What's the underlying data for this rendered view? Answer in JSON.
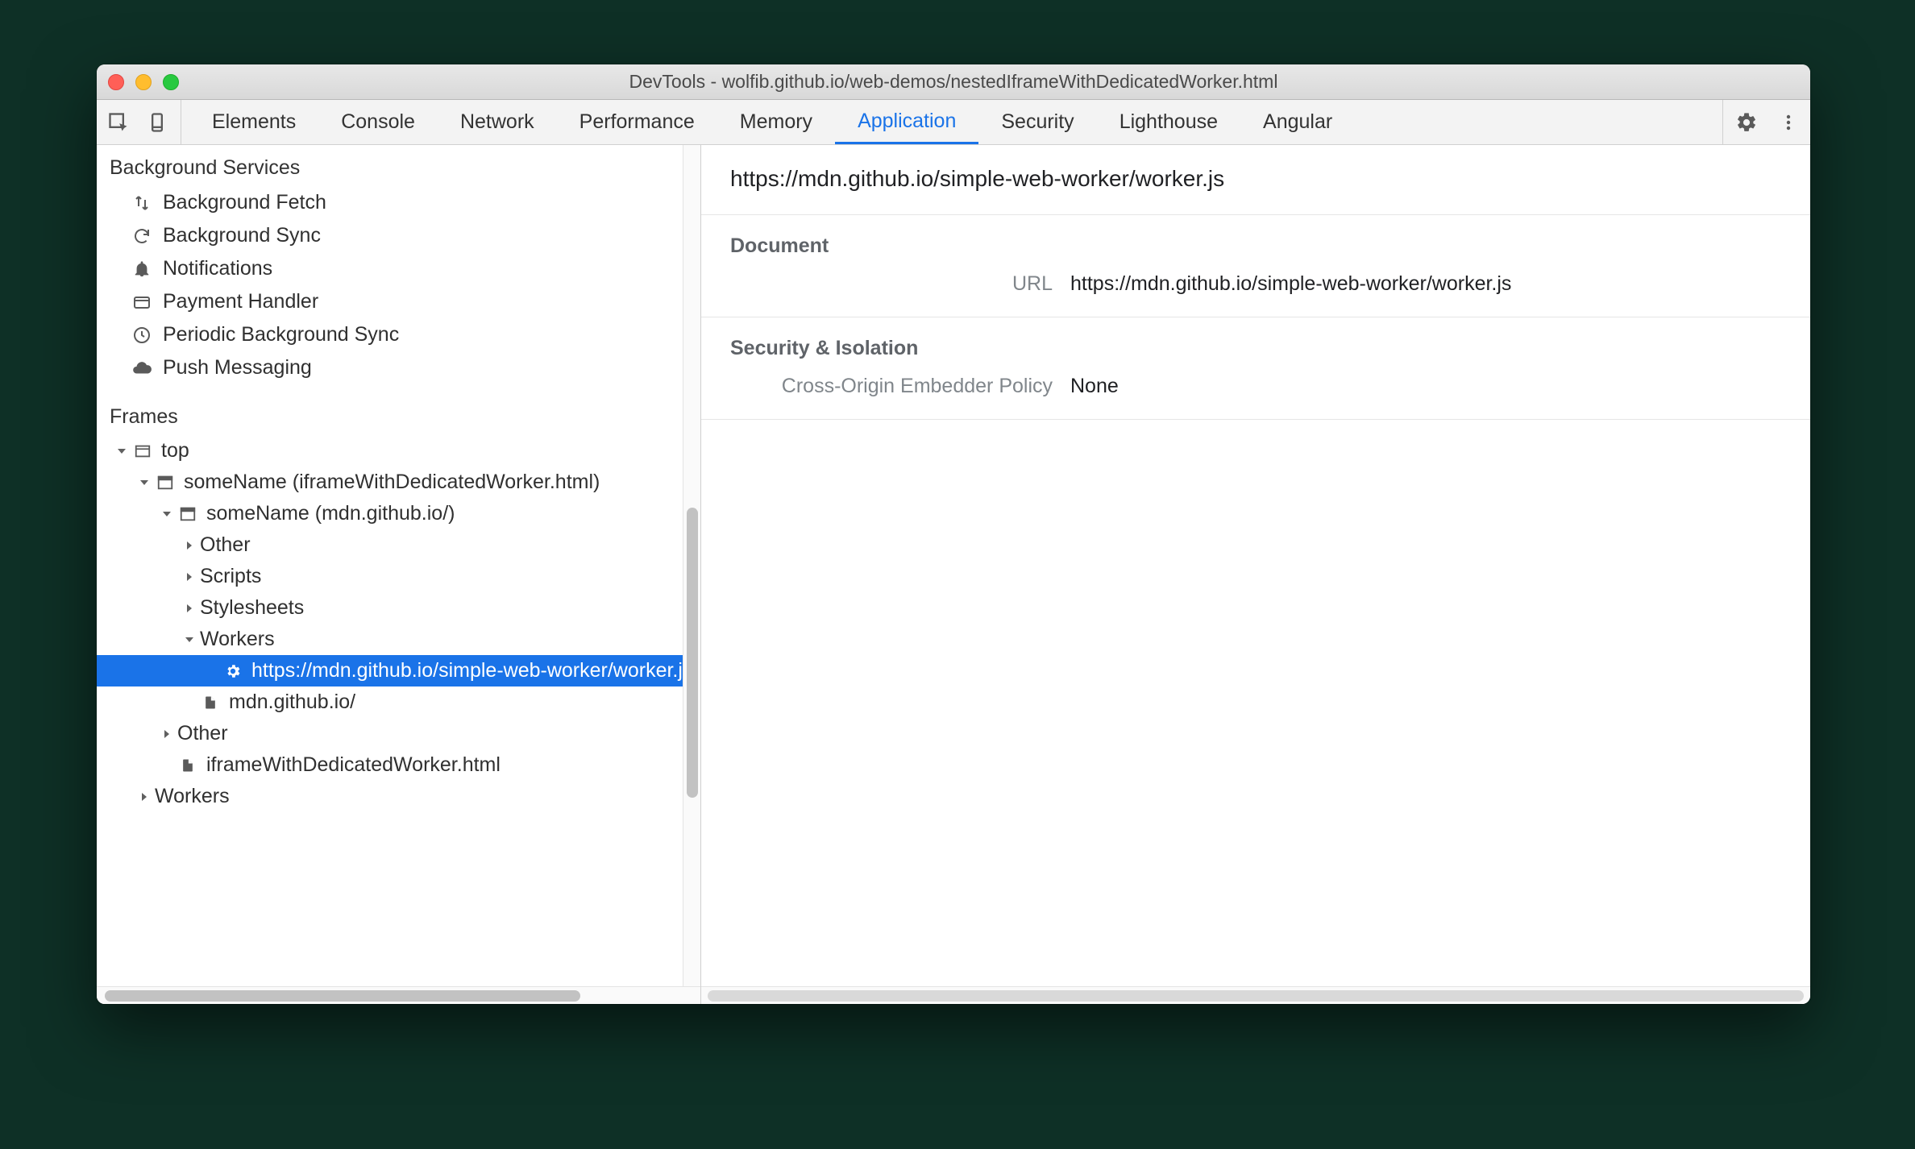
{
  "window": {
    "title": "DevTools - wolfib.github.io/web-demos/nestedIframeWithDedicatedWorker.html"
  },
  "tabs": [
    "Elements",
    "Console",
    "Network",
    "Performance",
    "Memory",
    "Application",
    "Security",
    "Lighthouse",
    "Angular"
  ],
  "activeTab": "Application",
  "sidebar": {
    "sections": {
      "bg": {
        "title": "Background Services",
        "items": [
          {
            "icon": "updown",
            "label": "Background Fetch"
          },
          {
            "icon": "sync",
            "label": "Background Sync"
          },
          {
            "icon": "bell",
            "label": "Notifications"
          },
          {
            "icon": "card",
            "label": "Payment Handler"
          },
          {
            "icon": "clock",
            "label": "Periodic Background Sync"
          },
          {
            "icon": "cloud",
            "label": "Push Messaging"
          }
        ]
      },
      "frames": {
        "title": "Frames",
        "tree": {
          "label": "top",
          "icon": "window",
          "expanded": true,
          "indent": 0,
          "children": [
            {
              "label": "someName (iframeWithDedicatedWorker.html)",
              "icon": "frame",
              "expanded": true,
              "indent": 1,
              "children": [
                {
                  "label": "someName (mdn.github.io/)",
                  "icon": "frame",
                  "expanded": true,
                  "indent": 2,
                  "children": [
                    {
                      "label": "Other",
                      "expanded": false,
                      "indent": 3
                    },
                    {
                      "label": "Scripts",
                      "expanded": false,
                      "indent": 3
                    },
                    {
                      "label": "Stylesheets",
                      "expanded": false,
                      "indent": 3
                    },
                    {
                      "label": "Workers",
                      "expanded": true,
                      "indent": 3,
                      "children": [
                        {
                          "label": "https://mdn.github.io/simple-web-worker/worker.js",
                          "icon": "gear",
                          "indent": 4,
                          "selected": true
                        }
                      ]
                    },
                    {
                      "label": "mdn.github.io/",
                      "icon": "file",
                      "indent": 3,
                      "leaf": true
                    }
                  ]
                },
                {
                  "label": "Other",
                  "expanded": false,
                  "indent": 2
                },
                {
                  "label": "iframeWithDedicatedWorker.html",
                  "icon": "file",
                  "indent": 2,
                  "leaf": true
                }
              ]
            },
            {
              "label": "Workers",
              "expanded": false,
              "indent": 1
            }
          ]
        }
      }
    }
  },
  "main": {
    "heading": "https://mdn.github.io/simple-web-worker/worker.js",
    "document": {
      "title": "Document",
      "url_label": "URL",
      "url_value": "https://mdn.github.io/simple-web-worker/worker.js"
    },
    "security": {
      "title": "Security & Isolation",
      "coep_label": "Cross-Origin Embedder Policy",
      "coep_value": "None"
    }
  }
}
